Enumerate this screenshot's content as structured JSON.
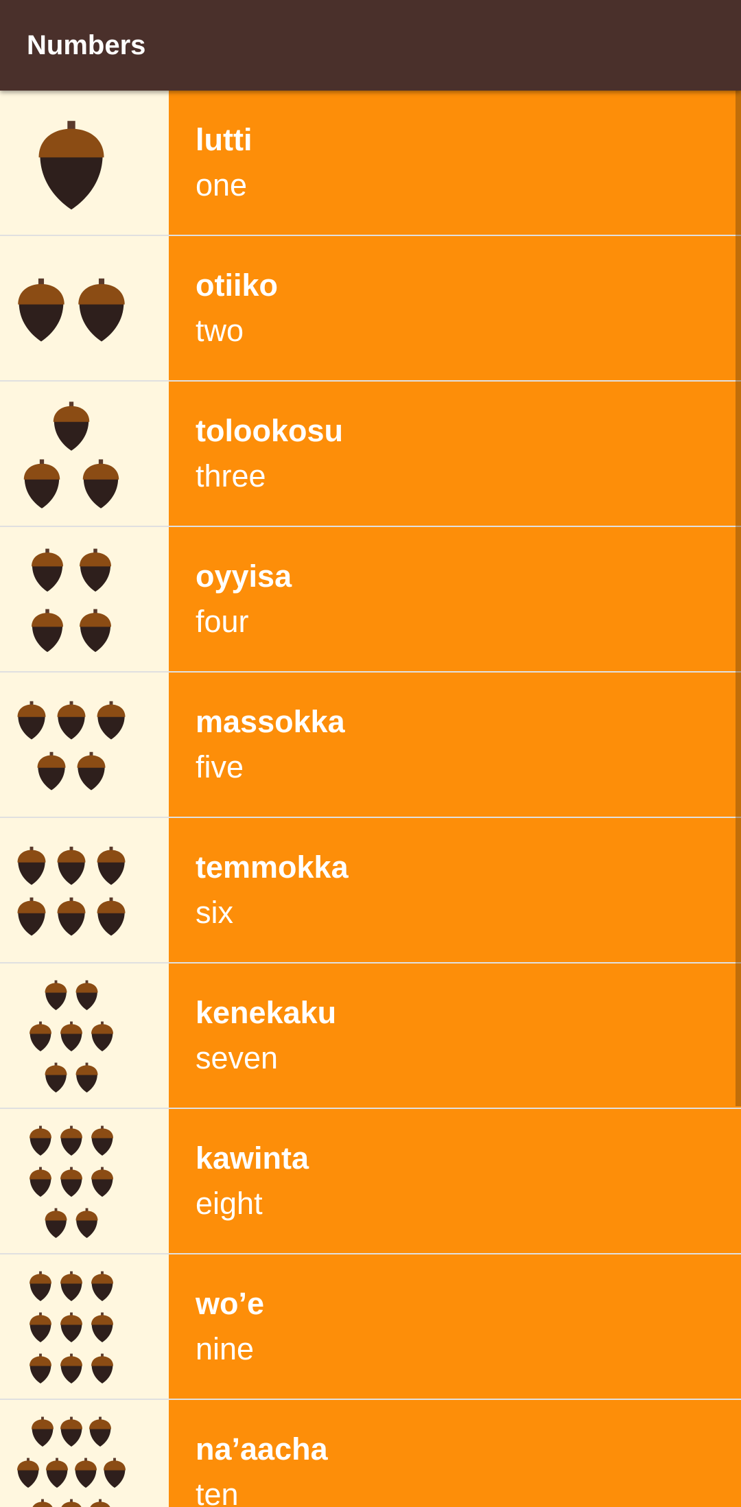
{
  "app_bar": {
    "title": "Numbers"
  },
  "colors": {
    "app_bar": "#4A302B",
    "category": "#FD8E09",
    "image_background": "#FFF7DF",
    "acorn_cap": "#8B4C14",
    "acorn_body": "#2E1F1C",
    "text": "#FFFFFF"
  },
  "icon": "acorn-icon",
  "words": [
    {
      "miwok": "lutti",
      "english": "one",
      "count": 1
    },
    {
      "miwok": "otiiko",
      "english": "two",
      "count": 2
    },
    {
      "miwok": "tolookosu",
      "english": "three",
      "count": 3
    },
    {
      "miwok": "oyyisa",
      "english": "four",
      "count": 4
    },
    {
      "miwok": "massokka",
      "english": "five",
      "count": 5
    },
    {
      "miwok": "temmokka",
      "english": "six",
      "count": 6
    },
    {
      "miwok": "kenekaku",
      "english": "seven",
      "count": 7
    },
    {
      "miwok": "kawinta",
      "english": "eight",
      "count": 8
    },
    {
      "miwok": "wo’e",
      "english": "nine",
      "count": 9
    },
    {
      "miwok": "na’aacha",
      "english": "ten",
      "count": 10
    }
  ]
}
